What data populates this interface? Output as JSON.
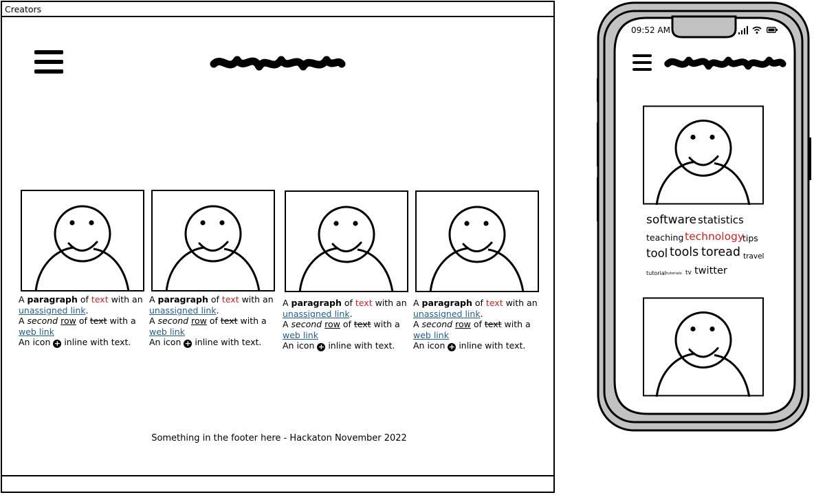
{
  "browser": {
    "title": "Creators"
  },
  "cards": [
    {
      "t1": "A ",
      "b": "paragraph",
      "t2": " of ",
      "red": "text",
      "t3": " with an",
      "link": "unassigned link",
      "t4": ".",
      "l2a": "A ",
      "it": "second",
      "l2b": " ",
      "ul": "row",
      "l2c": " of ",
      "st": "text",
      "l2d": " with a",
      "web": "web link",
      "l3a": "An icon ",
      "l3b": " inline with text."
    },
    {
      "t1": "A ",
      "b": "paragraph",
      "t2": " of ",
      "red": "text",
      "t3": " with an",
      "link": "unassigned link",
      "t4": ".",
      "l2a": "A ",
      "it": "second",
      "l2b": " ",
      "ul": "row",
      "l2c": " of ",
      "st": "text",
      "l2d": " with a",
      "web": "web link",
      "l3a": "An icon ",
      "l3b": " inline with text."
    },
    {
      "t1": "A ",
      "b": "paragraph",
      "t2": " of ",
      "red": "text",
      "t3": " with an",
      "link": "unassigned link",
      "t4": ".",
      "l2a": "A ",
      "it": "second",
      "l2b": " ",
      "ul": "row",
      "l2c": " of ",
      "st": "text",
      "l2d": " with a",
      "web": "web link",
      "l3a": "An icon ",
      "l3b": " inline with text."
    },
    {
      "t1": "A ",
      "b": "paragraph",
      "t2": " of ",
      "red": "text",
      "t3": " with an",
      "link": "unassigned link",
      "t4": ".",
      "l2a": "A ",
      "it": "second",
      "l2b": " ",
      "ul": "row",
      "l2c": " of ",
      "st": "text",
      "l2d": " with a",
      "web": "web link",
      "l3a": "An icon ",
      "l3b": " inline with text."
    }
  ],
  "footer": {
    "text": "Something in the footer here - Hackaton November 2022"
  },
  "phone": {
    "time": "09:52 AM",
    "tags": {
      "software": "software",
      "statistics": "statistics",
      "teaching": "teaching",
      "technology": "technology",
      "tips": "tips",
      "tool": "tool",
      "tools": "tools",
      "toread": "toread",
      "travel": "travel",
      "tutorial": "tutorial",
      "tutorials": "tutorials",
      "tv": "tv",
      "twitter": "twitter"
    }
  },
  "colors": {
    "link": "#1f5d99",
    "red_text": "#d42020",
    "phone_body": "#c2c2c2"
  },
  "icons": [
    "menu-icon",
    "plus-circle-icon",
    "signal-icon",
    "wifi-icon",
    "battery-icon"
  ]
}
